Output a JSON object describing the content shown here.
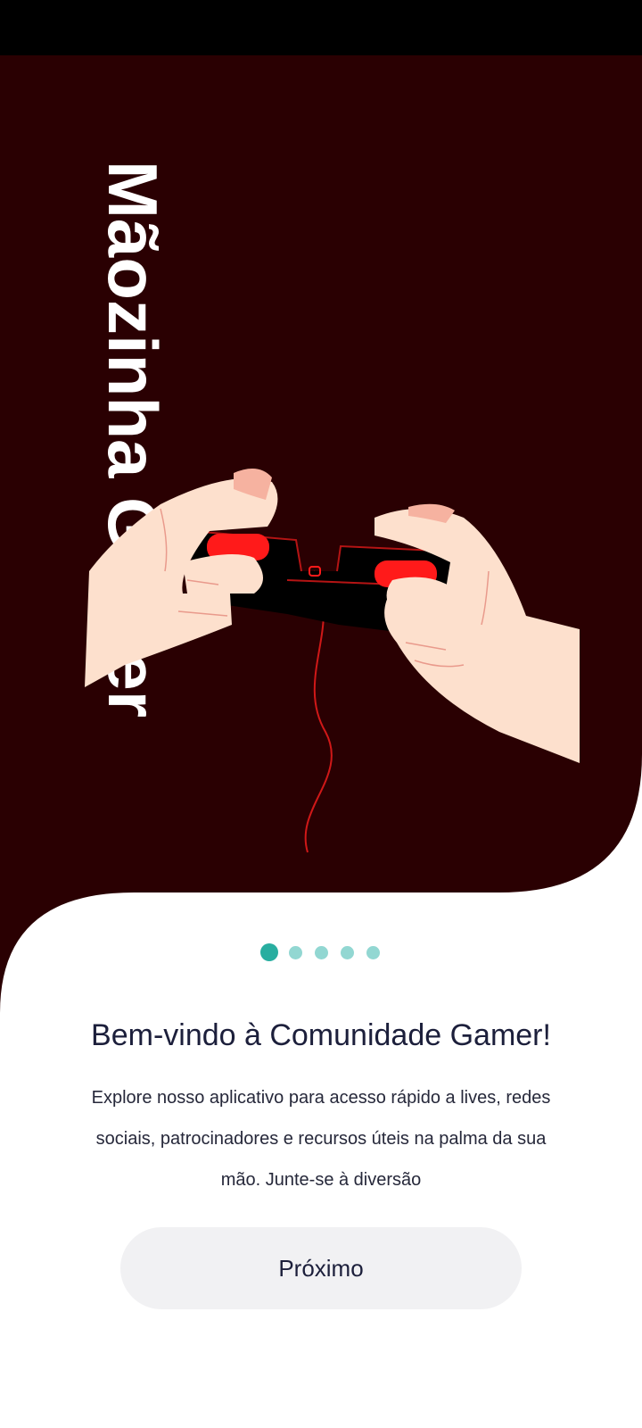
{
  "colors": {
    "hero_background": "#2a0002",
    "accent": "#28aea0",
    "accent_light": "#92d7d2",
    "controller_red": "#ff1a1a",
    "skin": "#fde0cd",
    "button_background": "#f1f1f3"
  },
  "hero": {
    "title": "Mãozinha Gamer",
    "illustration": "hands-holding-game-controller"
  },
  "pager": {
    "count": 5,
    "active_index": 0
  },
  "welcome": {
    "title": "Bem-vindo à Comunidade Gamer!",
    "body": "Explore nosso aplicativo para acesso rápido a lives, redes sociais, patrocinadores e recursos úteis na palma da sua mão. Junte-se à diversão"
  },
  "next_button": {
    "label": "Próximo"
  }
}
